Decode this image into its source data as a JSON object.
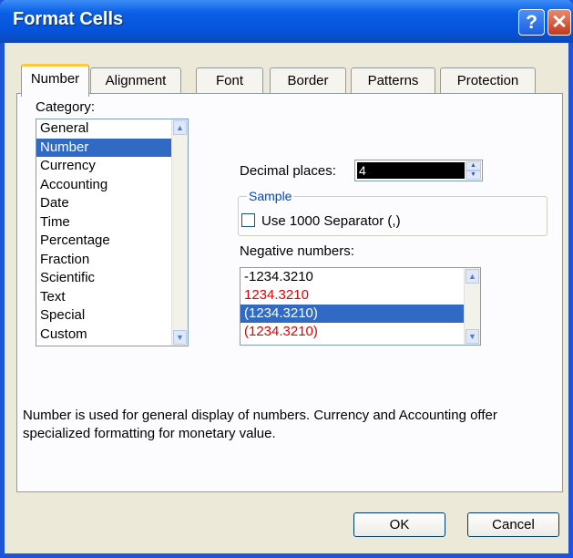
{
  "window": {
    "title": "Format Cells",
    "help_glyph": "?",
    "close_glyph": "✕"
  },
  "tabs": [
    {
      "label": "Number",
      "active": true
    },
    {
      "label": "Alignment",
      "active": false
    },
    {
      "label": "Font",
      "active": false
    },
    {
      "label": "Border",
      "active": false
    },
    {
      "label": "Patterns",
      "active": false
    },
    {
      "label": "Protection",
      "active": false
    }
  ],
  "category": {
    "label": "Category:",
    "items": [
      "General",
      "Number",
      "Currency",
      "Accounting",
      "Date",
      "Time",
      "Percentage",
      "Fraction",
      "Scientific",
      "Text",
      "Special",
      "Custom"
    ],
    "selected": "Number"
  },
  "sample": {
    "legend": "Sample",
    "value": ""
  },
  "decimal_places": {
    "label": "Decimal places:",
    "value": "4"
  },
  "use_separator": {
    "label": "Use 1000 Separator (,)",
    "checked": false
  },
  "negative_numbers": {
    "label": "Negative numbers:",
    "items": [
      {
        "text": "-1234.3210",
        "color": "#000000"
      },
      {
        "text": "1234.3210",
        "color": "#e00000"
      },
      {
        "text": "(1234.3210)",
        "color": "#000000",
        "selected": true
      },
      {
        "text": "(1234.3210)",
        "color": "#e00000"
      }
    ]
  },
  "description": "Number is used for general display of numbers.  Currency and Accounting offer specialized formatting for monetary value.",
  "buttons": {
    "ok": "OK",
    "cancel": "Cancel"
  },
  "colors": {
    "title_bar": "#0654dc",
    "selection": "#316ac5",
    "active_tab_accent": "#ffc83c",
    "negative_red": "#e00000"
  }
}
